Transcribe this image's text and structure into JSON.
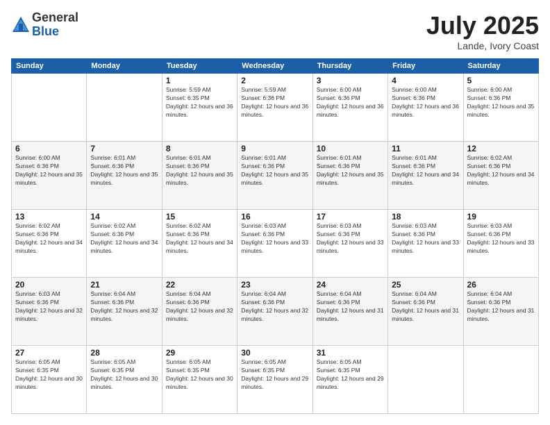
{
  "logo": {
    "general": "General",
    "blue": "Blue"
  },
  "header": {
    "month": "July 2025",
    "location": "Lande, Ivory Coast"
  },
  "weekdays": [
    "Sunday",
    "Monday",
    "Tuesday",
    "Wednesday",
    "Thursday",
    "Friday",
    "Saturday"
  ],
  "weeks": [
    [
      {
        "day": "",
        "info": ""
      },
      {
        "day": "",
        "info": ""
      },
      {
        "day": "1",
        "info": "Sunrise: 5:59 AM\nSunset: 6:35 PM\nDaylight: 12 hours and 36 minutes."
      },
      {
        "day": "2",
        "info": "Sunrise: 5:59 AM\nSunset: 6:36 PM\nDaylight: 12 hours and 36 minutes."
      },
      {
        "day": "3",
        "info": "Sunrise: 6:00 AM\nSunset: 6:36 PM\nDaylight: 12 hours and 36 minutes."
      },
      {
        "day": "4",
        "info": "Sunrise: 6:00 AM\nSunset: 6:36 PM\nDaylight: 12 hours and 36 minutes."
      },
      {
        "day": "5",
        "info": "Sunrise: 6:00 AM\nSunset: 6:36 PM\nDaylight: 12 hours and 35 minutes."
      }
    ],
    [
      {
        "day": "6",
        "info": "Sunrise: 6:00 AM\nSunset: 6:36 PM\nDaylight: 12 hours and 35 minutes."
      },
      {
        "day": "7",
        "info": "Sunrise: 6:01 AM\nSunset: 6:36 PM\nDaylight: 12 hours and 35 minutes."
      },
      {
        "day": "8",
        "info": "Sunrise: 6:01 AM\nSunset: 6:36 PM\nDaylight: 12 hours and 35 minutes."
      },
      {
        "day": "9",
        "info": "Sunrise: 6:01 AM\nSunset: 6:36 PM\nDaylight: 12 hours and 35 minutes."
      },
      {
        "day": "10",
        "info": "Sunrise: 6:01 AM\nSunset: 6:36 PM\nDaylight: 12 hours and 35 minutes."
      },
      {
        "day": "11",
        "info": "Sunrise: 6:01 AM\nSunset: 6:36 PM\nDaylight: 12 hours and 34 minutes."
      },
      {
        "day": "12",
        "info": "Sunrise: 6:02 AM\nSunset: 6:36 PM\nDaylight: 12 hours and 34 minutes."
      }
    ],
    [
      {
        "day": "13",
        "info": "Sunrise: 6:02 AM\nSunset: 6:36 PM\nDaylight: 12 hours and 34 minutes."
      },
      {
        "day": "14",
        "info": "Sunrise: 6:02 AM\nSunset: 6:36 PM\nDaylight: 12 hours and 34 minutes."
      },
      {
        "day": "15",
        "info": "Sunrise: 6:02 AM\nSunset: 6:36 PM\nDaylight: 12 hours and 34 minutes."
      },
      {
        "day": "16",
        "info": "Sunrise: 6:03 AM\nSunset: 6:36 PM\nDaylight: 12 hours and 33 minutes."
      },
      {
        "day": "17",
        "info": "Sunrise: 6:03 AM\nSunset: 6:36 PM\nDaylight: 12 hours and 33 minutes."
      },
      {
        "day": "18",
        "info": "Sunrise: 6:03 AM\nSunset: 6:36 PM\nDaylight: 12 hours and 33 minutes."
      },
      {
        "day": "19",
        "info": "Sunrise: 6:03 AM\nSunset: 6:36 PM\nDaylight: 12 hours and 33 minutes."
      }
    ],
    [
      {
        "day": "20",
        "info": "Sunrise: 6:03 AM\nSunset: 6:36 PM\nDaylight: 12 hours and 32 minutes."
      },
      {
        "day": "21",
        "info": "Sunrise: 6:04 AM\nSunset: 6:36 PM\nDaylight: 12 hours and 32 minutes."
      },
      {
        "day": "22",
        "info": "Sunrise: 6:04 AM\nSunset: 6:36 PM\nDaylight: 12 hours and 32 minutes."
      },
      {
        "day": "23",
        "info": "Sunrise: 6:04 AM\nSunset: 6:36 PM\nDaylight: 12 hours and 32 minutes."
      },
      {
        "day": "24",
        "info": "Sunrise: 6:04 AM\nSunset: 6:36 PM\nDaylight: 12 hours and 31 minutes."
      },
      {
        "day": "25",
        "info": "Sunrise: 6:04 AM\nSunset: 6:36 PM\nDaylight: 12 hours and 31 minutes."
      },
      {
        "day": "26",
        "info": "Sunrise: 6:04 AM\nSunset: 6:36 PM\nDaylight: 12 hours and 31 minutes."
      }
    ],
    [
      {
        "day": "27",
        "info": "Sunrise: 6:05 AM\nSunset: 6:35 PM\nDaylight: 12 hours and 30 minutes."
      },
      {
        "day": "28",
        "info": "Sunrise: 6:05 AM\nSunset: 6:35 PM\nDaylight: 12 hours and 30 minutes."
      },
      {
        "day": "29",
        "info": "Sunrise: 6:05 AM\nSunset: 6:35 PM\nDaylight: 12 hours and 30 minutes."
      },
      {
        "day": "30",
        "info": "Sunrise: 6:05 AM\nSunset: 6:35 PM\nDaylight: 12 hours and 29 minutes."
      },
      {
        "day": "31",
        "info": "Sunrise: 6:05 AM\nSunset: 6:35 PM\nDaylight: 12 hours and 29 minutes."
      },
      {
        "day": "",
        "info": ""
      },
      {
        "day": "",
        "info": ""
      }
    ]
  ]
}
